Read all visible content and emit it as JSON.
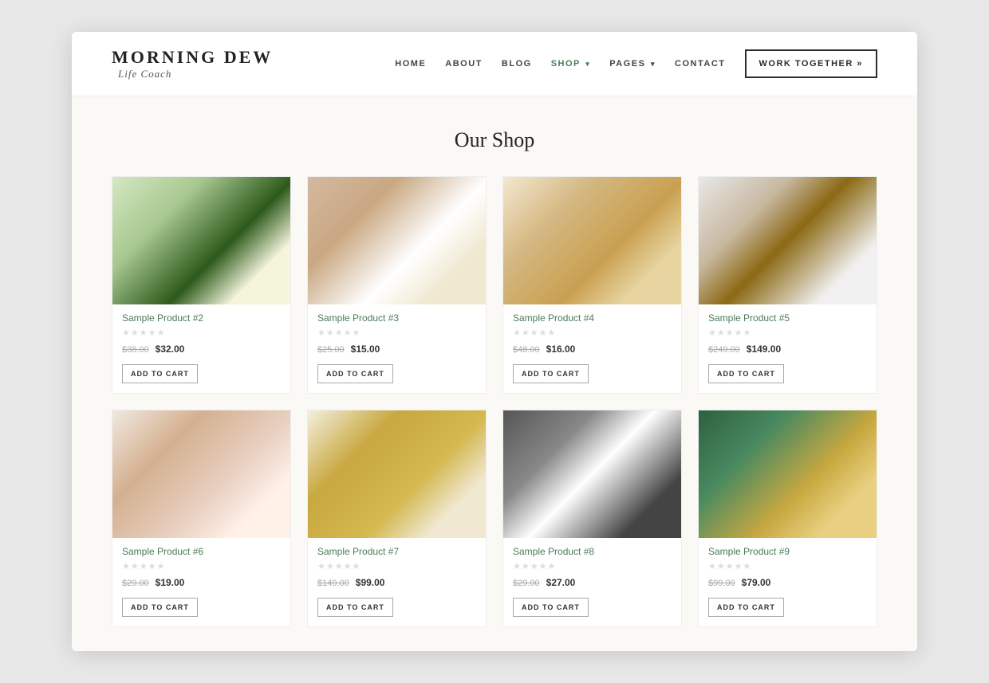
{
  "site": {
    "logo_title": "MORNING DEW",
    "logo_subtitle": "Life Coach"
  },
  "nav": {
    "items": [
      {
        "label": "HOME",
        "active": false
      },
      {
        "label": "ABOUT",
        "active": false
      },
      {
        "label": "BLOG",
        "active": false
      },
      {
        "label": "SHOP",
        "active": true,
        "has_arrow": true
      },
      {
        "label": "PAGES",
        "active": false,
        "has_arrow": true
      },
      {
        "label": "CONTACT",
        "active": false
      }
    ],
    "cta_label": "WORK TOGETHER »"
  },
  "shop": {
    "title": "Our Shop",
    "products": [
      {
        "id": "p2",
        "name": "Sample Product #2",
        "price_original": "$38.00",
        "price_sale": "$32.00",
        "add_to_cart": "ADD TO CART",
        "img_class": "img-p2"
      },
      {
        "id": "p3",
        "name": "Sample Product #3",
        "price_original": "$25.00",
        "price_sale": "$15.00",
        "add_to_cart": "ADD TO CART",
        "img_class": "img-p3"
      },
      {
        "id": "p4",
        "name": "Sample Product #4",
        "price_original": "$48.00",
        "price_sale": "$16.00",
        "add_to_cart": "ADD TO CART",
        "img_class": "img-p4"
      },
      {
        "id": "p5",
        "name": "Sample Product #5",
        "price_original": "$249.00",
        "price_sale": "$149.00",
        "add_to_cart": "ADD TO CART",
        "img_class": "img-p5"
      },
      {
        "id": "p6",
        "name": "Sample Product #6",
        "price_original": "$29.00",
        "price_sale": "$19.00",
        "add_to_cart": "ADD TO CART",
        "img_class": "img-p6"
      },
      {
        "id": "p7",
        "name": "Sample Product #7",
        "price_original": "$149.00",
        "price_sale": "$99.00",
        "add_to_cart": "ADD TO CART",
        "img_class": "img-p7"
      },
      {
        "id": "p8",
        "name": "Sample Product #8",
        "price_original": "$29.00",
        "price_sale": "$27.00",
        "add_to_cart": "ADD TO CART",
        "img_class": "img-p8"
      },
      {
        "id": "p9",
        "name": "Sample Product #9",
        "price_original": "$99.00",
        "price_sale": "$79.00",
        "add_to_cart": "ADD TO CART",
        "img_class": "img-p9"
      }
    ]
  }
}
